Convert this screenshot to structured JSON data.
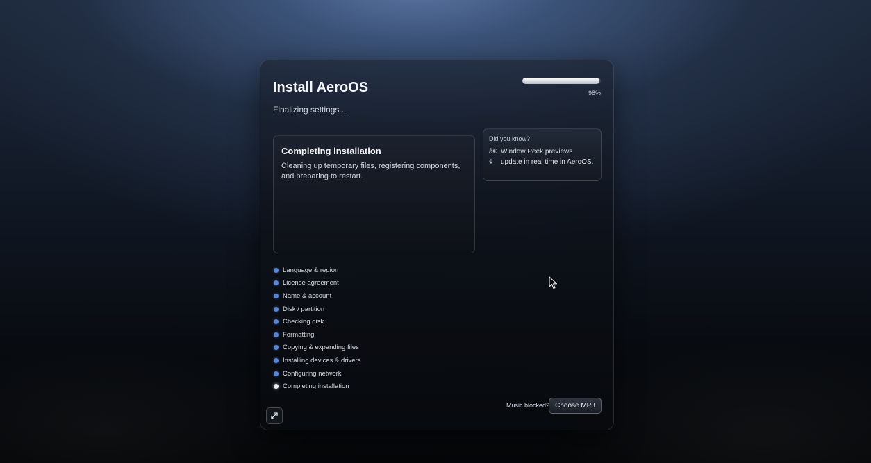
{
  "installer": {
    "title": "Install AeroOS",
    "subtitle": "Finalizing settings...",
    "progress_percent": 98,
    "progress_label": "98%"
  },
  "current_step_card": {
    "title": "Completing installation",
    "description": "Cleaning up temporary files, registering components, and preparing to restart."
  },
  "tip": {
    "heading": "Did you know?",
    "bullet": "â€\n¢",
    "text": "Window Peek previews update in real time in AeroOS."
  },
  "steps": [
    {
      "label": "Language & region",
      "state": "done"
    },
    {
      "label": "License agreement",
      "state": "done"
    },
    {
      "label": "Name & account",
      "state": "done"
    },
    {
      "label": "Disk / partition",
      "state": "done"
    },
    {
      "label": "Checking disk",
      "state": "done"
    },
    {
      "label": "Formatting",
      "state": "done"
    },
    {
      "label": "Copying & expanding files",
      "state": "done"
    },
    {
      "label": "Installing devices & drivers",
      "state": "done"
    },
    {
      "label": "Configuring network",
      "state": "done"
    },
    {
      "label": "Completing installation",
      "state": "current"
    }
  ],
  "music": {
    "label": "Music blocked?",
    "button_label": "Choose MP3"
  },
  "icons": {
    "expand": "expand-icon",
    "cursor": "mouse-pointer-icon"
  },
  "colors": {
    "step_done": "#5b86d6",
    "step_current": "#e8ebf0"
  }
}
